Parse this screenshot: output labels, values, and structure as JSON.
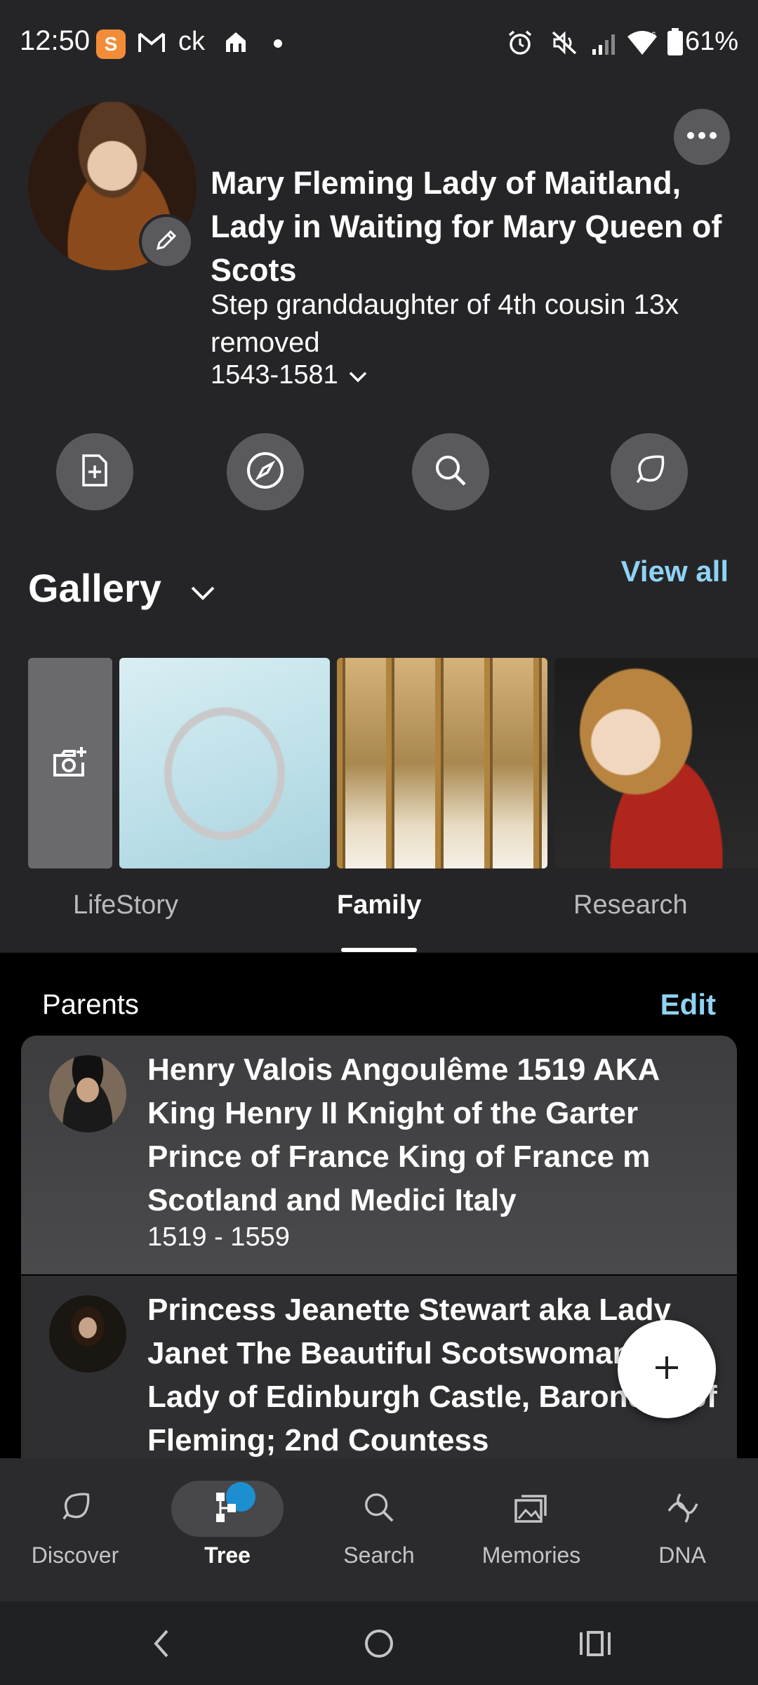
{
  "status_bar": {
    "time": "12:50",
    "badge": "S",
    "apps": "ck",
    "battery": "61%"
  },
  "person": {
    "name": "Mary Fleming Lady of Maitland, Lady in Waiting for Mary Queen of Scots",
    "relation": "Step granddaughter of 4th cousin 13x removed",
    "dates": "1543-1581"
  },
  "gallery": {
    "title": "Gallery",
    "view_all": "View all"
  },
  "tabs": [
    {
      "label": "LifeStory",
      "active": false
    },
    {
      "label": "Family",
      "active": true
    },
    {
      "label": "Research",
      "active": false
    }
  ],
  "family": {
    "section_label": "Parents",
    "edit_label": "Edit",
    "parents": [
      {
        "name": "Henry Valois Angoulême 1519 AKA King Henry II Knight of the Garter Prince of France King of France m Scotland and Medici Italy",
        "dates": "1519 - 1559"
      },
      {
        "name": "Princess Jeanette Stewart aka Lady Janet The Beautiful Scotswoman aka Lady of Edinburgh Castle, Baroness of Fleming; 2nd Countess",
        "dates": ""
      }
    ]
  },
  "bottom_nav": [
    {
      "label": "Discover",
      "icon": "discover-icon",
      "active": false
    },
    {
      "label": "Tree",
      "icon": "tree-icon",
      "active": true
    },
    {
      "label": "Search",
      "icon": "search-icon",
      "active": false
    },
    {
      "label": "Memories",
      "icon": "memories-icon",
      "active": false
    },
    {
      "label": "DNA",
      "icon": "dna-icon",
      "active": false
    }
  ],
  "colors": {
    "background": "#252528",
    "accent_link": "#8fd3f4",
    "notification": "#1d8fd1",
    "button_gray": "#5a5a5e"
  }
}
